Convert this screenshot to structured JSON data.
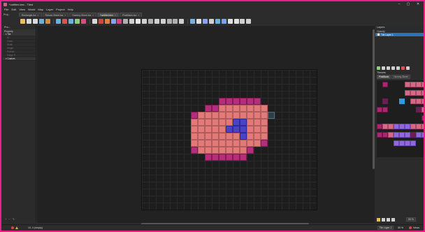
{
  "window": {
    "title": "*untitled.tmx - Tiled",
    "controls": [
      "–",
      "▢",
      "✕"
    ]
  },
  "menu": [
    "File",
    "Edit",
    "View",
    "World",
    "Map",
    "Layer",
    "Project",
    "Help"
  ],
  "project_label": "Proj...",
  "tabs": [
    {
      "label": "Rectangle.tsx",
      "active": false
    },
    {
      "label": "Retuxs-Sheet.tsx",
      "active": false
    },
    {
      "label": "Hummy-Sheet.tsx",
      "active": false
    },
    {
      "label": "*untitled.tmx",
      "active": true
    },
    {
      "label": "PinkBlank.tsx",
      "active": false
    }
  ],
  "toolbar_colors": [
    "#e9c348",
    "#d9d9d9",
    "#d9d9d9",
    "#6ab0e0",
    "#d88a3a",
    "#6ab0e0",
    "#e05050",
    "#6ab0e0",
    "#8ad07a",
    "#d05080",
    "#d9d9d9",
    "#e04040",
    "#e08040",
    "#8aa0ff",
    "#e04080",
    "#b0b0b0",
    "#d0d0d0",
    "#e8e8e8",
    "#d0d0d0",
    "#b0b0b0",
    "#d0d0d0",
    "#d0d0d0",
    "#b0b0b0",
    "#b0b0b0",
    "#d0d0d0",
    "#7ab0e0",
    "#e0e0e0",
    "#8aa0ff",
    "#d0d0d0",
    "#6ab0e0",
    "#7aa0ff",
    "#e0e0e0",
    "#e0e0e0",
    "#d0d0d0",
    "#d0d0d0"
  ],
  "properties": {
    "header": "Pro...",
    "sub": "Property",
    "rows": [
      {
        "label": "Tile",
        "group": true
      },
      {
        "label": "ID",
        "group": false
      },
      {
        "label": "Class",
        "group": false
      },
      {
        "label": "Width",
        "group": false
      },
      {
        "label": "Height",
        "group": false
      },
      {
        "label": "Probab...",
        "group": false
      },
      {
        "label": "Image R...",
        "group": false
      },
      {
        "label": "Custom",
        "group": true
      }
    ]
  },
  "layers": {
    "header": "Layers",
    "opacity_label": "Opacity:",
    "layer_name": "Tile Layer 1"
  },
  "tilesets": {
    "header": "Tilesets",
    "tabs": [
      "PinkBlank",
      "Hummy-Sheet"
    ]
  },
  "statusbar": {
    "layer_select": "Tile Layer 1",
    "zoom_right": "50 %",
    "zoom_main": "50 %",
    "news": "News",
    "coords": "10, 4 (empty)"
  },
  "map_colors": {
    "pink": "#e27a7a",
    "magenta": "#b42e7a",
    "blue": "#4a43c4"
  }
}
